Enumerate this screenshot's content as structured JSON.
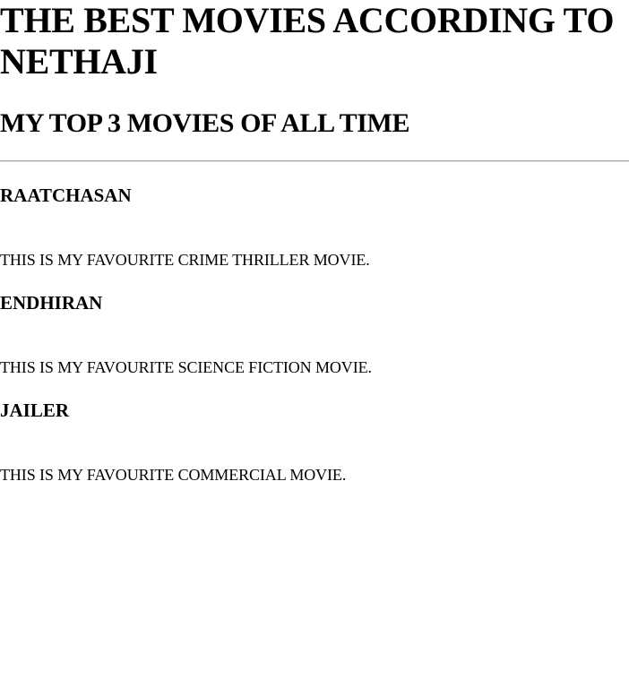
{
  "header": {
    "title": "THE BEST MOVIES ACCORDING TO NETHAJI",
    "subtitle": "MY TOP 3 MOVIES OF ALL TIME"
  },
  "movies": [
    {
      "name": "RAATCHASAN",
      "description": "THIS IS MY FAVOURITE CRIME THRILLER MOVIE."
    },
    {
      "name": "ENDHIRAN",
      "description": "THIS IS MY FAVOURITE SCIENCE FICTION MOVIE."
    },
    {
      "name": "JAILER",
      "description": "THIS IS MY FAVOURITE COMMERCIAL MOVIE."
    }
  ]
}
